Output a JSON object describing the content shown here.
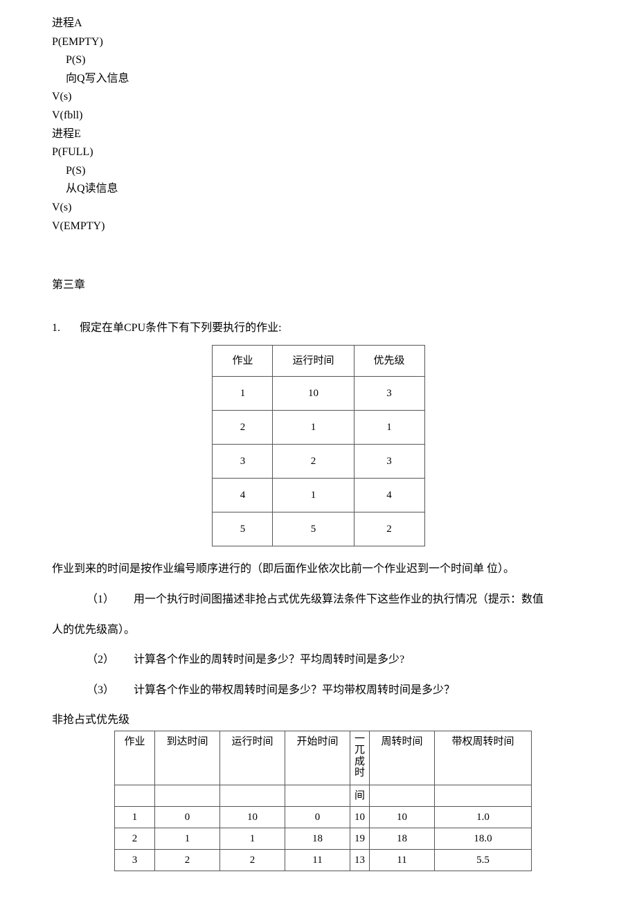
{
  "code": {
    "procA_title": "进程A",
    "line1": "P(EMPTY)",
    "line2": "P(S)",
    "line3": "向Q写入信息",
    "line4": "V(s)",
    "line5": "V(fbll)",
    "procE_title": "进程E",
    "line6": "P(FULL)",
    "line7": "P(S)",
    "line8": "从Q读信息",
    "line9": "V(s)",
    "line10": "V(EMPTY)"
  },
  "chapter": "第三章",
  "q1": {
    "num": "1.",
    "text": "假定在单CPU条件下有下列要执行的作业:"
  },
  "table1": {
    "headers": [
      "作业",
      "运行时间",
      "优先级"
    ],
    "rows": [
      [
        "1",
        "10",
        "3"
      ],
      [
        "2",
        "1",
        "1"
      ],
      [
        "3",
        "2",
        "3"
      ],
      [
        "4",
        "1",
        "4"
      ],
      [
        "5",
        "5",
        "2"
      ]
    ]
  },
  "para1": "作业到来的时间是按作业编号顺序进行的（即后面作业依次比前一个作业迟到一个时间单 位）。",
  "sub1": {
    "num": "（1）",
    "text": "用一个执行时间图描述非抢占式优先级算法条件下这些作业的执行情况（提示：数值"
  },
  "sub1_cont": "人的优先级高）。",
  "sub2": {
    "num": "（2）",
    "text": "计算各个作业的周转时间是多少？平均周转时间是多少?"
  },
  "sub3": {
    "num": "（3）",
    "text": "计算各个作业的带权周转时间是多少？平均带权周转时间是多少？"
  },
  "table2_title": "非抢占式优先级",
  "table2": {
    "headers": {
      "job": "作业",
      "arrive": "到达时间",
      "run": "运行时间",
      "start": "开始时间",
      "finish_p1": "一\n兀\n成\n时",
      "finish_p2": "间",
      "turn": "周转时间",
      "wturn": "带权周转时间"
    },
    "rows": [
      [
        "1",
        "0",
        "10",
        "0",
        "10",
        "10",
        "1.0"
      ],
      [
        "2",
        "1",
        "1",
        "18",
        "19",
        "18",
        "18.0"
      ],
      [
        "3",
        "2",
        "2",
        "11",
        "13",
        "11",
        "5.5"
      ]
    ]
  }
}
